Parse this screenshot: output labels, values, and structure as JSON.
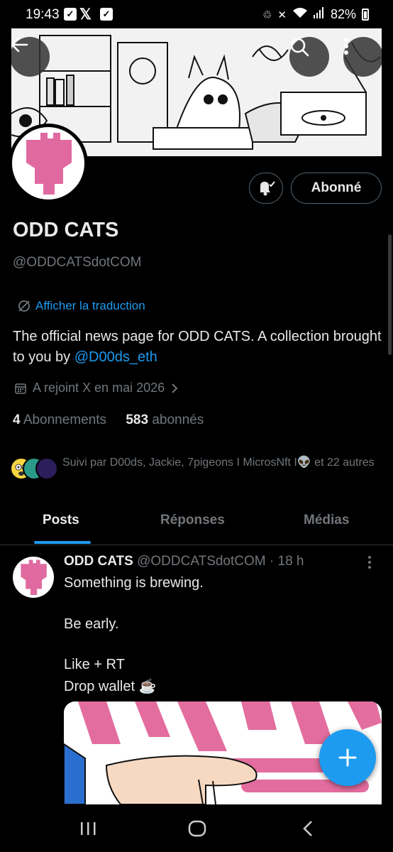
{
  "status_bar": {
    "time": "19:43",
    "battery": "82%",
    "icons": [
      "v-app-icon",
      "x-app-icon",
      "check-app-icon",
      "recycle-icon",
      "mute-icon",
      "wifi-icon",
      "signal-icon",
      "battery-icon"
    ]
  },
  "profile": {
    "name": "ODD CATS",
    "handle": "@ODDCATSdotCOM",
    "translate_label": "Afficher la traduction",
    "bio_text": "The official news page for ODD CATS.   A collection brought to you by ",
    "bio_link": "@D00ds_eth",
    "joined": "A rejoint X en mai 2026",
    "following_count": "4",
    "following_label": "Abonnements",
    "followers_count": "583",
    "followers_label": "abonnés",
    "followed_by": "Suivi par D00ds, Jackie, 7pigeons I MicrosNft I👽 et 22 autres",
    "follow_button": "Abonné"
  },
  "tabs": [
    {
      "label": "Posts",
      "active": true
    },
    {
      "label": "Réponses",
      "active": false
    },
    {
      "label": "Médias",
      "active": false
    }
  ],
  "post": {
    "author": "ODD CATS",
    "handle": "@ODDCATSdotCOM",
    "time": "· 18 h",
    "lines": [
      "Something is brewing.",
      "Be early.",
      "Like + RT",
      "Drop wallet ☕"
    ]
  },
  "colors": {
    "accent": "#1d9bf0",
    "background": "#000000",
    "brand_pink": "#e06aa0",
    "muted_text": "#71767b"
  }
}
